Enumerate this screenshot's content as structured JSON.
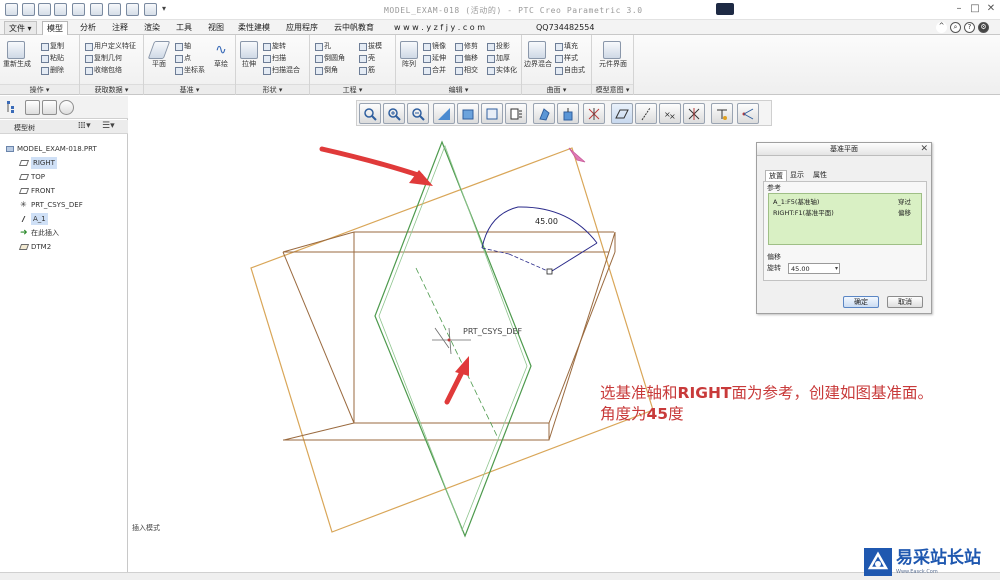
{
  "window": {
    "title": "MODEL_EXAM-018 (活动的) - PTC Creo Parametric 3.0"
  },
  "menu": {
    "tabs": [
      "文件",
      "模型",
      "分析",
      "注释",
      "渲染",
      "工具",
      "视图",
      "柔性建模",
      "应用程序",
      "云中帆教育",
      "w w w . y z f j y . c o m",
      "QQ734482554"
    ],
    "active": "模型"
  },
  "ribbon": {
    "groups": [
      {
        "title": "操作",
        "items": [
          "重新生成",
          "复制",
          "粘贴",
          "删除"
        ]
      },
      {
        "title": "获取数据",
        "items": [
          "用户定义特征",
          "复制几何",
          "收缩包络"
        ]
      },
      {
        "title": "基准",
        "items": [
          "平面",
          "轴",
          "点",
          "坐标系",
          "草绘"
        ]
      },
      {
        "title": "形状",
        "items": [
          "拉伸",
          "旋转",
          "扫描",
          "扫描混合"
        ]
      },
      {
        "title": "工程",
        "items": [
          "孔",
          "倒圆角",
          "倒角",
          "拔模",
          "壳",
          "筋"
        ]
      },
      {
        "title": "编辑",
        "items": [
          "阵列",
          "镜像",
          "延伸",
          "合并",
          "修剪",
          "偏移",
          "相交",
          "投影",
          "加厚",
          "实体化"
        ]
      },
      {
        "title": "曲面",
        "items": [
          "边界混合",
          "填充",
          "样式",
          "自由式"
        ]
      },
      {
        "title": "模型意图",
        "items": [
          "元件界面"
        ]
      }
    ]
  },
  "tree": {
    "header": "模型树",
    "items": [
      "MODEL_EXAM-018.PRT",
      "RIGHT",
      "TOP",
      "FRONT",
      "PRT_CSYS_DEF",
      "A_1",
      "在此插入",
      "DTM2"
    ],
    "selected": "RIGHT"
  },
  "dialog": {
    "title": "基准平面",
    "tabs": [
      "放置",
      "显示",
      "属性"
    ],
    "active_tab": "放置",
    "ref_label": "参考",
    "references": [
      {
        "name": "A_1:F5(基准轴)",
        "constraint": "穿过"
      },
      {
        "name": "RIGHT:F1(基准平面)",
        "constraint": "偏移"
      }
    ],
    "offset_label": "偏移",
    "rotation_label": "旋转",
    "rotation_value": "45.00",
    "ok_label": "确定",
    "cancel_label": "取消"
  },
  "canvas": {
    "dimension_label": "45.00",
    "csys_label": "PRT_CSYS_DEF"
  },
  "annotation": {
    "line1_pre": "选基准轴和",
    "line1_bold": "RIGHT",
    "line1_post": "面为参考，创建如图基准面。",
    "line2_pre": "角度为",
    "line2_bold": "45",
    "line2_post": "度"
  },
  "status": {
    "text": "插入模式"
  },
  "watermark": {
    "text": "易采站长站",
    "url": "Www.Easck.Com"
  },
  "colors": {
    "arrow": "#e03a3a",
    "plane_orange": "#d9a658",
    "plane_brown": "#9a6a3f",
    "plane_green": "#4d9a4d",
    "dimension": "#2a2a8a",
    "annotation": "#c83a3a",
    "reference_bg": "#d9f0c4"
  }
}
